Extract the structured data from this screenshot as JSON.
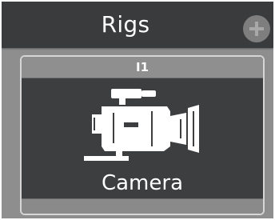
{
  "header": {
    "title": "Rigs",
    "add_icon": "plus-icon"
  },
  "rig_card": {
    "id_label": "I1",
    "icon": "video-camera-icon",
    "name": "Camera"
  },
  "colors": {
    "header_bg": "#3a3b3c",
    "panel_bg": "#8e8e8e",
    "card_bg": "#3c3e40",
    "card_border": "#d6d6d6",
    "text": "#ffffff"
  }
}
